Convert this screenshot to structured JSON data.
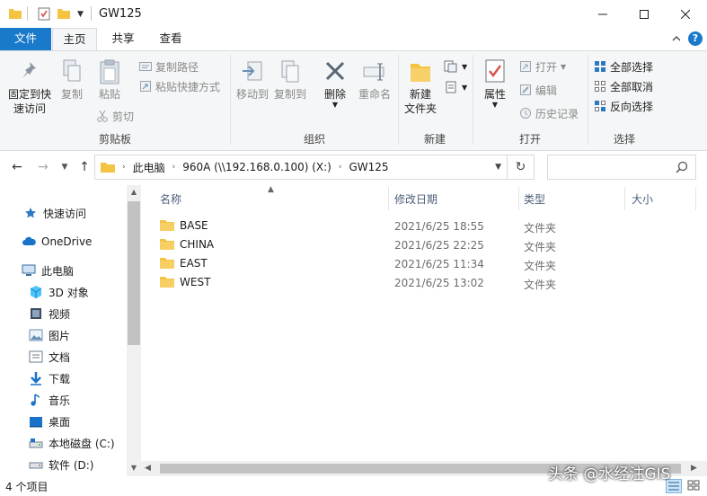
{
  "window": {
    "title": "GW125"
  },
  "tabs": [
    {
      "label": "文件"
    },
    {
      "label": "主页"
    },
    {
      "label": "共享"
    },
    {
      "label": "查看"
    }
  ],
  "ribbon": {
    "clipboard": {
      "pin_label_1": "固定到快",
      "pin_label_2": "速访问",
      "copy_label": "复制",
      "paste_label": "粘贴",
      "copy_path_label": "复制路径",
      "paste_shortcut_label": "粘贴快捷方式",
      "cut_label": "剪切",
      "group_label": "剪贴板"
    },
    "organize": {
      "move_to_label": "移动到",
      "copy_to_label": "复制到",
      "delete_label": "删除",
      "rename_label": "重命名",
      "group_label": "组织"
    },
    "new": {
      "new_folder_label_1": "新建",
      "new_folder_label_2": "文件夹",
      "group_label": "新建"
    },
    "open": {
      "properties_label": "属性",
      "open_label": "打开",
      "edit_label": "编辑",
      "history_label": "历史记录",
      "group_label": "打开"
    },
    "select": {
      "select_all_label": "全部选择",
      "select_none_label": "全部取消",
      "invert_label": "反向选择",
      "group_label": "选择"
    }
  },
  "address": {
    "crumbs": [
      "此电脑",
      "960A (\\\\192.168.0.100) (X:)",
      "GW125"
    ],
    "search_placeholder": ""
  },
  "nav_pane": {
    "items": [
      {
        "label": "快速访问",
        "icon": "star-icon"
      },
      {
        "label": "OneDrive",
        "icon": "cloud-icon"
      },
      {
        "label": "此电脑",
        "icon": "computer-icon"
      },
      {
        "label": "3D 对象",
        "icon": "cube-icon"
      },
      {
        "label": "视频",
        "icon": "video-icon"
      },
      {
        "label": "图片",
        "icon": "picture-icon"
      },
      {
        "label": "文档",
        "icon": "document-icon"
      },
      {
        "label": "下载",
        "icon": "download-icon"
      },
      {
        "label": "音乐",
        "icon": "music-icon"
      },
      {
        "label": "桌面",
        "icon": "desktop-icon"
      },
      {
        "label": "本地磁盘 (C:)",
        "icon": "drive-icon"
      },
      {
        "label": "软件 (D:)",
        "icon": "drive-icon"
      }
    ]
  },
  "file_list": {
    "columns": [
      {
        "label": "名称"
      },
      {
        "label": "修改日期"
      },
      {
        "label": "类型"
      },
      {
        "label": "大小"
      }
    ],
    "rows": [
      {
        "name": "BASE",
        "date": "2021/6/25 18:55",
        "type": "文件夹"
      },
      {
        "name": "CHINA",
        "date": "2021/6/25 22:25",
        "type": "文件夹"
      },
      {
        "name": "EAST",
        "date": "2021/6/25 11:34",
        "type": "文件夹"
      },
      {
        "name": "WEST",
        "date": "2021/6/25 13:02",
        "type": "文件夹"
      }
    ]
  },
  "status": {
    "item_count": "4 个项目"
  },
  "watermark": "头条 @水经注GIS",
  "colors": {
    "accent": "#1979ca",
    "folder": "#f5c342",
    "ribbon_bg": "#f5f6f7"
  }
}
